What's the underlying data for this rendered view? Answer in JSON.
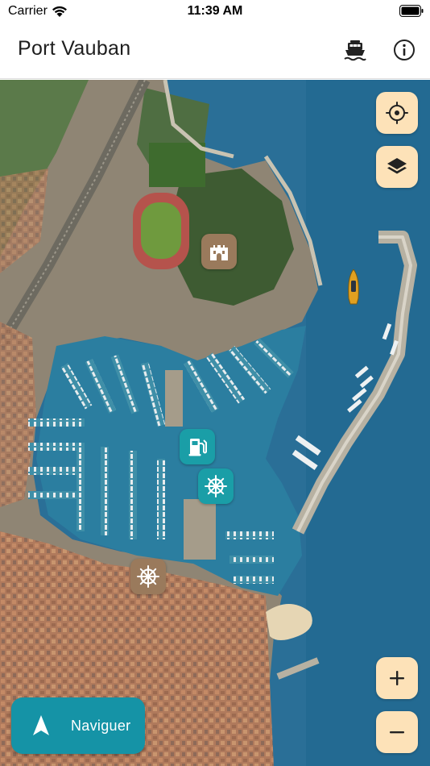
{
  "status_bar": {
    "carrier": "Carrier",
    "time": "11:39 AM"
  },
  "nav_bar": {
    "title": "Port Vauban",
    "icons": [
      "ferry-icon",
      "info-icon"
    ]
  },
  "map": {
    "controls": [
      "locate-icon",
      "layers-icon",
      "plus-icon",
      "minus-icon"
    ],
    "pois": [
      {
        "type": "fort",
        "color": "#9a7a5c"
      },
      {
        "type": "fuel",
        "color": "#1a9ea7"
      },
      {
        "type": "harbour-office",
        "color": "#1a9ea7"
      },
      {
        "type": "harbour-master",
        "color": "#9a7a5c"
      }
    ],
    "sea_color": "#2a6f97",
    "land_color": "#8f8574"
  },
  "navigate_button": {
    "label": "Naviguer",
    "color": "#1593a6"
  }
}
